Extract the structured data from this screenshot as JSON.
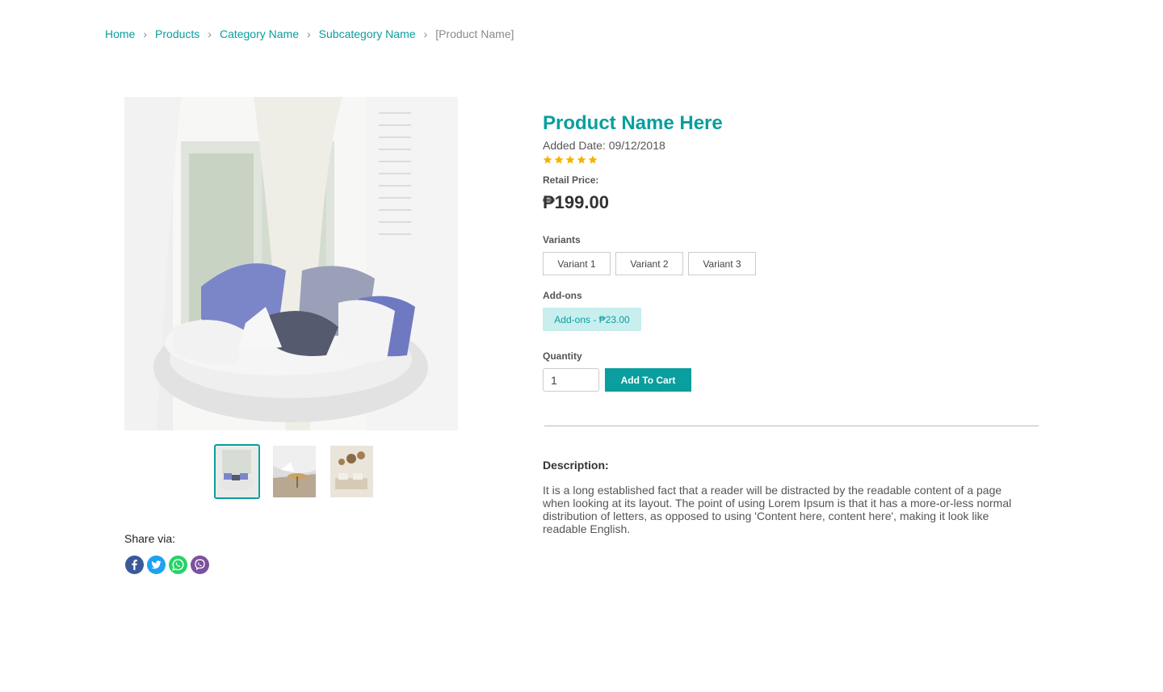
{
  "breadcrumb": {
    "items": [
      "Home",
      "Products",
      "Category Name",
      "Subcategory Name"
    ],
    "current": "[Product Name]",
    "separator": "›"
  },
  "product": {
    "name": "Product Name Here",
    "added_date": "Added Date: 09/12/2018",
    "rating": 5,
    "rating_max": 5,
    "retail_price_label": "Retail Price:",
    "price": "₱199.00"
  },
  "variants": {
    "label": "Variants",
    "options": [
      "Variant 1",
      "Variant 2",
      "Variant 3"
    ]
  },
  "addons": {
    "label": "Add-ons",
    "option": "Add-ons - ₱23.00"
  },
  "quantity": {
    "label": "Quantity",
    "value": "1"
  },
  "cart": {
    "button_label": "Add To Cart"
  },
  "description": {
    "title": "Description:",
    "text": "It is a long established fact that a reader will be distracted by the readable content of a page when looking at its layout. The point of  using Lorem Ipsum is that it has a more-or-less normal distribution of letters, as opposed to using 'Content here, content here',  making it look like readable English."
  },
  "share": {
    "label": "Share via:",
    "icons": [
      "facebook-icon",
      "twitter-icon",
      "whatsapp-icon",
      "viber-icon"
    ]
  },
  "colors": {
    "accent": "#0a9e9e",
    "addon_bg": "#c9eeee",
    "star": "#f5b301"
  }
}
